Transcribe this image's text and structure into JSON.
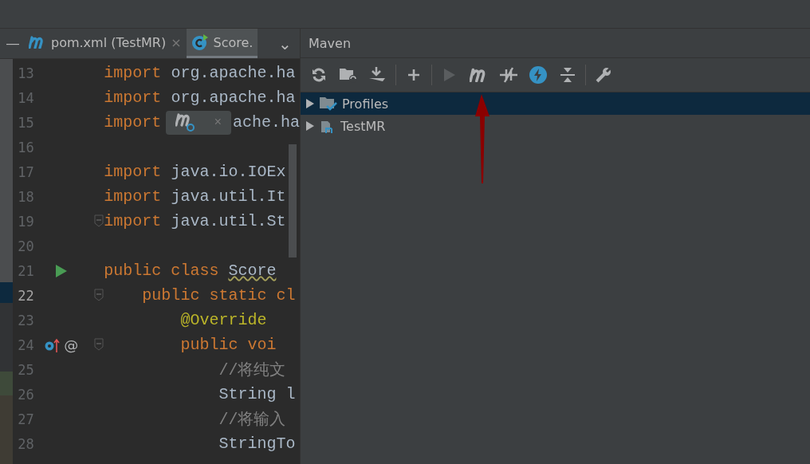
{
  "editor": {
    "hide_button": "—",
    "tabs": [
      {
        "label": "pom.xml (TestMR)",
        "kind": "maven",
        "selected": false,
        "close": "×"
      },
      {
        "label": "Score.",
        "kind": "java",
        "selected": true
      }
    ],
    "tab_menu": "⌄",
    "popup": {
      "close": "×"
    },
    "lines": [
      {
        "number": "13",
        "tokens": [
          {
            "kind": "keyword",
            "text": "import"
          },
          {
            "kind": "plain",
            "text": " org.apache.ha"
          }
        ]
      },
      {
        "number": "14",
        "tokens": [
          {
            "kind": "keyword",
            "text": "import"
          },
          {
            "kind": "plain",
            "text": " org.apache.ha"
          }
        ]
      },
      {
        "number": "15",
        "tokens": [
          {
            "kind": "keyword",
            "text": "import"
          },
          {
            "kind": "popup"
          },
          {
            "kind": "plain",
            "text": "ache.ha"
          }
        ]
      },
      {
        "number": "16"
      },
      {
        "number": "17",
        "tokens": [
          {
            "kind": "keyword",
            "text": "import"
          },
          {
            "kind": "plain",
            "text": " java.io.IOEx"
          }
        ]
      },
      {
        "number": "18",
        "tokens": [
          {
            "kind": "keyword",
            "text": "import"
          },
          {
            "kind": "plain",
            "text": " java.util.It"
          }
        ]
      },
      {
        "number": "19",
        "fold": true,
        "tokens": [
          {
            "kind": "keyword",
            "text": "import"
          },
          {
            "kind": "plain",
            "text": " java.util.St"
          }
        ]
      },
      {
        "number": "20"
      },
      {
        "number": "21",
        "runnable": true,
        "tokens": [
          {
            "kind": "keyword",
            "text": "public class "
          },
          {
            "kind": "warn",
            "text": "Score"
          }
        ]
      },
      {
        "number": "22",
        "fold": true,
        "current": true,
        "tokens": [
          {
            "kind": "keyword",
            "text": "    public static cl"
          }
        ]
      },
      {
        "number": "23",
        "tokens": [
          {
            "kind": "annotation",
            "text": "        @Override"
          }
        ]
      },
      {
        "number": "24",
        "overrides": true,
        "annotation_mark": "@",
        "fold": true,
        "tokens": [
          {
            "kind": "keyword",
            "text": "        public voi"
          }
        ]
      },
      {
        "number": "25",
        "tokens": [
          {
            "kind": "comment",
            "text": "            //将纯文"
          }
        ]
      },
      {
        "number": "26",
        "tokens": [
          {
            "kind": "plain",
            "text": "            String l"
          }
        ]
      },
      {
        "number": "27",
        "tokens": [
          {
            "kind": "comment",
            "text": "            //将输入"
          }
        ]
      },
      {
        "number": "28",
        "tokens": [
          {
            "kind": "plain",
            "text": "            StringTo"
          }
        ]
      }
    ]
  },
  "maven": {
    "title": "Maven",
    "toolbar": [
      {
        "kind": "refresh",
        "disabled": false
      },
      {
        "kind": "folder-refresh",
        "disabled": false
      },
      {
        "kind": "download",
        "disabled": false
      },
      {
        "kind": "sep"
      },
      {
        "kind": "plus",
        "disabled": false
      },
      {
        "kind": "sep"
      },
      {
        "kind": "run",
        "disabled": true
      },
      {
        "kind": "m",
        "disabled": false
      },
      {
        "kind": "skip",
        "disabled": false
      },
      {
        "kind": "bolt",
        "disabled": false
      },
      {
        "kind": "collapse",
        "disabled": false
      },
      {
        "kind": "sep"
      },
      {
        "kind": "wrench",
        "disabled": false
      }
    ],
    "tree": [
      {
        "label": "Profiles",
        "kind": "profiles",
        "expanded": false,
        "selected": true
      },
      {
        "label": "TestMR",
        "kind": "project",
        "expanded": false,
        "selected": false
      }
    ]
  }
}
